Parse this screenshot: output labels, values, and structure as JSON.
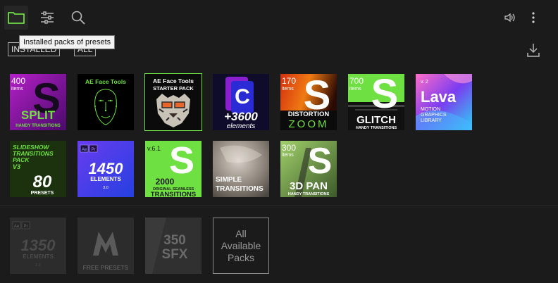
{
  "colors": {
    "accent": "#6fe042",
    "background": "#1b1b1b"
  },
  "toolbar": {
    "folder_icon": "folder-icon",
    "settings_icon": "sliders-icon",
    "search_icon": "search-icon",
    "volume_icon": "volume-icon",
    "menu_icon": "more-vertical-icon",
    "tooltip": "Installed packs of presets"
  },
  "filters": {
    "installed_label": "INSTALLED",
    "all_label": "ALL",
    "download_icon": "download-icon"
  },
  "packs": {
    "split": {
      "count": "400",
      "unit": "items",
      "title": "SPLIT",
      "subtitle": "HANDY TRANSITIONS"
    },
    "face_tools": {
      "title": "AE Face Tools"
    },
    "face_starter": {
      "title": "AE Face Tools",
      "subtitle": "STARTER PACK"
    },
    "elements3600": {
      "title": "+3600",
      "subtitle": "elements"
    },
    "distortion": {
      "count": "170",
      "unit": "items",
      "title": "DISTORTION",
      "subtitle": "ZOOM"
    },
    "glitch": {
      "count": "700",
      "unit": "items",
      "title": "GLITCH",
      "subtitle": "HANDY TRANSITIONS"
    },
    "lava": {
      "version": "v. 2",
      "title": "Lava",
      "subtitle1": "MOTION",
      "subtitle2": "GRAPHICS",
      "subtitle3": "LIBRARY"
    },
    "slideshow": {
      "line1": "SLIDESHOW",
      "line2": "TRANSITIONS",
      "line3": "PACK",
      "line4": "V3",
      "count": "80",
      "unit": "PRESETS"
    },
    "elements1450": {
      "title": "1450",
      "subtitle": "ELEMENTS",
      "version": "3.0"
    },
    "seamless": {
      "version": "v.6.1",
      "count": "2000",
      "line1": "ORIGINAL SEAMLESS",
      "line2": "TRANSITIONS"
    },
    "simple": {
      "line1": "SIMPLE",
      "line2": "TRANSITIONS"
    },
    "pan3d": {
      "count": "300",
      "unit": "items",
      "title": "3D PAN",
      "subtitle": "HANDY TRANSITIONS"
    },
    "elements1350": {
      "title": "1350",
      "subtitle": "ELEMENTS",
      "version": "2.0"
    },
    "free": {
      "title": "FREE PRESETS"
    },
    "sfx": {
      "line1": "350",
      "line2": "SFX"
    },
    "all_available": "All\nAvailable\nPacks"
  }
}
